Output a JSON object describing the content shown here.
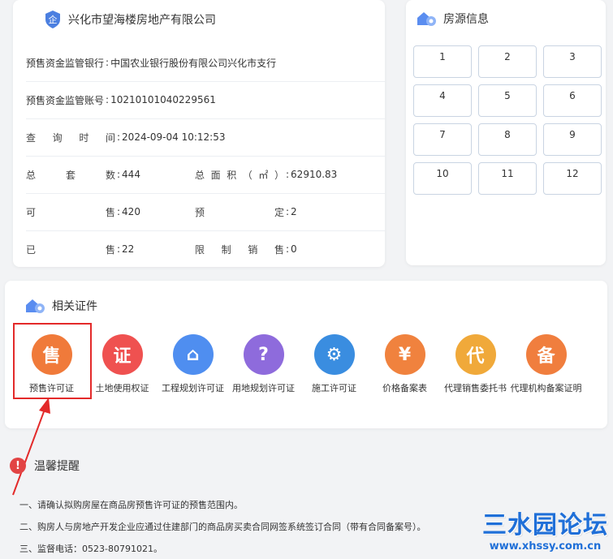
{
  "company": {
    "name": "兴化市望海楼房地产有限公司",
    "shield_char": "企"
  },
  "info": {
    "bank": {
      "label": "预售资金监管银行",
      "value": "中国农业银行股份有限公司兴化市支行"
    },
    "account": {
      "label": "预售资金监管账号",
      "value": "10210101040229561"
    },
    "query_time": {
      "label_chars": [
        "查",
        "询",
        "时",
        "间"
      ],
      "value": "2024-09-04 10:12:53"
    },
    "total_sets": {
      "label_chars": [
        "总",
        "套",
        "数"
      ],
      "value": "444"
    },
    "total_area": {
      "label_chars": [
        "总",
        "面",
        "积",
        "（",
        "㎡",
        "）"
      ],
      "value": "62910.83"
    },
    "available": {
      "label_chars": [
        "可",
        "售"
      ],
      "value": "420"
    },
    "reserved": {
      "label_chars": [
        "预",
        "定"
      ],
      "value": "2"
    },
    "sold": {
      "label_chars": [
        "已",
        "售"
      ],
      "value": "22"
    },
    "restricted": {
      "label_chars": [
        "限",
        "制",
        "销",
        "售"
      ],
      "value": "0"
    }
  },
  "housing_source": {
    "title": "房源信息",
    "buildings": [
      "1",
      "2",
      "3",
      "4",
      "5",
      "6",
      "7",
      "8",
      "9",
      "10",
      "11",
      "12"
    ]
  },
  "certificates": {
    "title": "相关证件",
    "items": [
      {
        "label": "预售许可证",
        "glyph": "售",
        "color": "#f07a3a"
      },
      {
        "label": "土地使用权证",
        "glyph": "证",
        "color": "#ef5150"
      },
      {
        "label": "工程规划许可证",
        "glyph": "⌂",
        "color": "#4f8ef0"
      },
      {
        "label": "用地规划许可证",
        "glyph": "?",
        "color": "#8e6bdc"
      },
      {
        "label": "施工许可证",
        "glyph": "⚙",
        "color": "#3a8de0"
      },
      {
        "label": "价格备案表",
        "glyph": "¥",
        "color": "#f0823e"
      },
      {
        "label": "代理销售委托书",
        "glyph": "代",
        "color": "#f0a93a"
      },
      {
        "label": "代理机构备案证明",
        "glyph": "备",
        "color": "#f07e3e"
      }
    ]
  },
  "tips": {
    "title": "温馨提醒",
    "lines": [
      "一、请确认拟购房屋在商品房预售许可证的预售范围内。",
      "二、购房人与房地产开发企业应通过住建部门的商品房买卖合同网签系统签订合同（带有合同备案号）。",
      "三、监督电话：0523-80791021。"
    ]
  },
  "watermark": {
    "main": "三水园论坛",
    "sub": "www.xhssy.com.cn"
  }
}
